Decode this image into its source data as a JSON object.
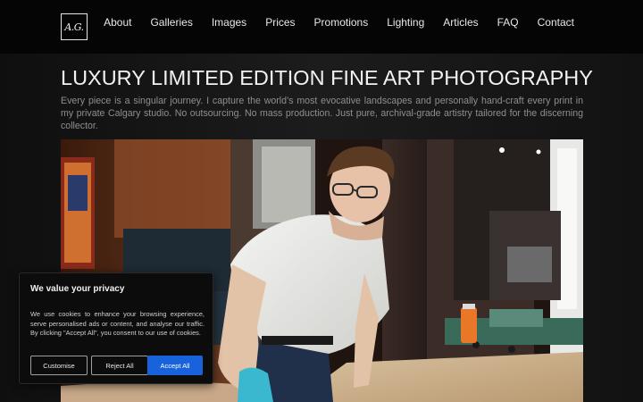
{
  "header": {
    "logo_text": "A.G.",
    "nav": [
      "About",
      "Galleries",
      "Images",
      "Prices",
      "Promotions",
      "Lighting",
      "Articles",
      "FAQ",
      "Contact"
    ]
  },
  "hero": {
    "title": "LUXURY LIMITED EDITION FINE ART PHOTOGRAPHY",
    "intro": "Every piece is a singular journey. I capture the world’s most evocative landscapes and personally hand-craft every print in my private Calgary studio. No outsourcing. No mass production. Just pure, archival-grade artistry tailored for the discerning collector."
  },
  "cookie": {
    "title": "We value your privacy",
    "body": "We use cookies to enhance your browsing experience, serve personalised ads or content, and analyse our traffic. By clicking \"Accept All\", you consent to our use of cookies.",
    "customise": "Customise",
    "reject": "Reject All",
    "accept": "Accept All"
  },
  "colors": {
    "accent": "#1863dc",
    "header_bg": "#050505"
  }
}
